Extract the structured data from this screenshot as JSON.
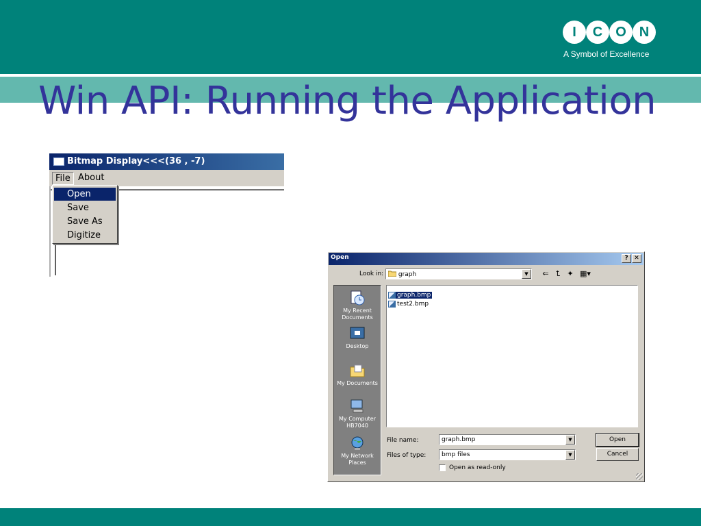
{
  "slide": {
    "title": "Win API: Running the Application",
    "logo": {
      "letters": [
        "I",
        "C",
        "O",
        "N"
      ],
      "tagline": "A Symbol of Excellence"
    },
    "colors": {
      "teal": "#00827a",
      "band": "#63b8ae",
      "title": "#33339a"
    }
  },
  "app_window": {
    "title": "Bitmap Display<<<(36 , -7)",
    "menu": [
      "File",
      "About"
    ],
    "file_menu": {
      "items": [
        "Open",
        "Save",
        "Save As",
        "Digitize"
      ],
      "selected": "Open"
    }
  },
  "open_dialog": {
    "title": "Open",
    "help_label": "?",
    "close_label": "✕",
    "look_in_label": "Look in:",
    "look_in_value": "graph",
    "places": [
      "My Recent Documents",
      "Desktop",
      "My Documents",
      "My Computer HB7040",
      "My Network Places"
    ],
    "files": [
      {
        "name": "graph.bmp",
        "selected": true
      },
      {
        "name": "test2.bmp",
        "selected": false
      }
    ],
    "file_name_label": "File name:",
    "file_name_value": "graph.bmp",
    "file_type_label": "Files of type:",
    "file_type_value": "bmp files",
    "read_only_label": "Open as read-only",
    "read_only_checked": false,
    "open_button": "Open",
    "cancel_button": "Cancel"
  }
}
